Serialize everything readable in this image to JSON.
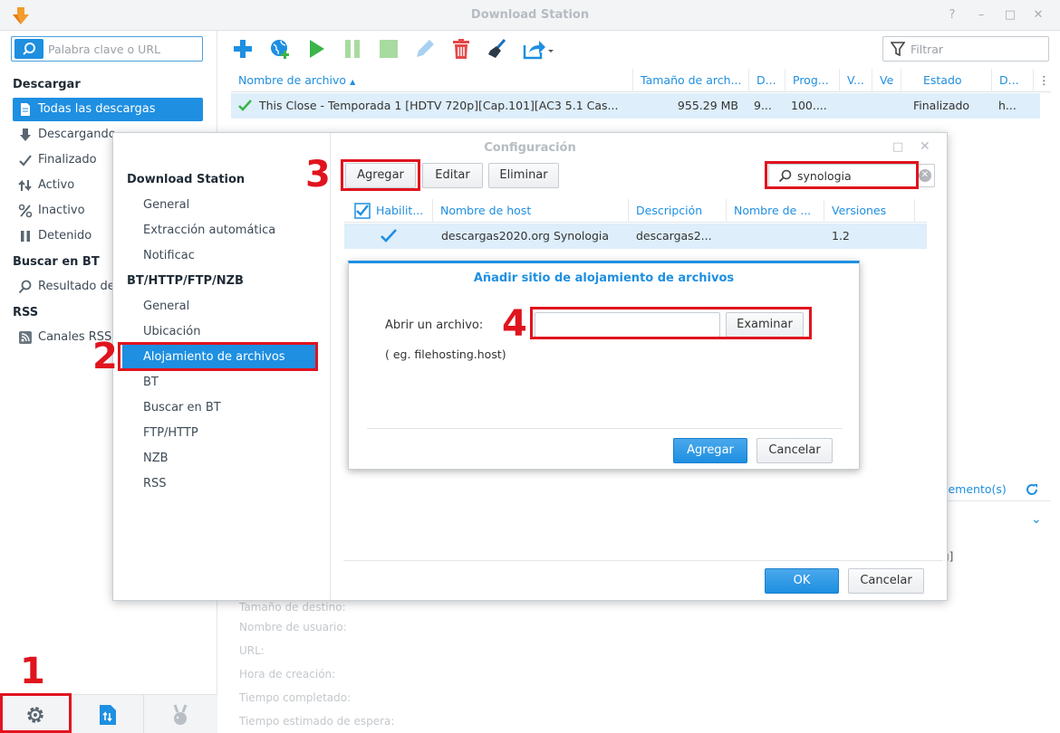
{
  "window": {
    "title": "Download Station"
  },
  "sidebar": {
    "search_placeholder": "Palabra clave o URL",
    "sections": {
      "descargar": "Descargar",
      "buscar_bt": "Buscar en BT",
      "rss": "RSS"
    },
    "items": [
      {
        "label": "Todas las descargas",
        "icon": "document-icon"
      },
      {
        "label": "Descargando",
        "icon": "arrow-down-icon"
      },
      {
        "label": "Finalizado",
        "icon": "checkmark-icon"
      },
      {
        "label": "Activo",
        "icon": "up-down-arrows-icon"
      },
      {
        "label": "Inactivo",
        "icon": "percent-icon"
      },
      {
        "label": "Detenido",
        "icon": "pause-icon"
      },
      {
        "label": "Resultado de",
        "icon": "search-icon"
      },
      {
        "label": "Canales RSS",
        "icon": "rss-icon"
      }
    ]
  },
  "toolbar": {
    "filter_placeholder": "Filtrar"
  },
  "grid": {
    "columns": [
      "Nombre de archivo",
      "Tamaño de arch...",
      "D...",
      "Prog...",
      "V...",
      "Ve",
      "Estado",
      "D..."
    ],
    "rows": [
      {
        "name": "This Close - Temporada 1 [HDTV 720p][Cap.101][AC3 5.1 Cas...",
        "size": "955.29 MB",
        "d": "9...",
        "progress": "100....",
        "status": "Finalizado",
        "d2": "h..."
      }
    ]
  },
  "background_info": {
    "elementos": "lemento(s)",
    "labels": [
      "Tamaño de destino:",
      "Nombre de usuario:",
      "URL:",
      "Hora de creación:",
      "Tiempo completado:",
      "Tiempo estimado de espera:"
    ]
  },
  "config_dialog": {
    "title": "Configuración",
    "nav": {
      "section1": "Download Station",
      "section1_items": [
        "General",
        "Extracción automática",
        "Notificac"
      ],
      "section2": "BT/HTTP/FTP/NZB",
      "section2_items": [
        "General",
        "Ubicación",
        "Alojamiento de archivos",
        "BT",
        "Buscar en BT",
        "FTP/HTTP",
        "NZB",
        "RSS"
      ]
    },
    "buttons": {
      "add": "Agregar",
      "edit": "Editar",
      "delete": "Eliminar",
      "ok": "OK",
      "cancel": "Cancelar"
    },
    "search_value": "synologia",
    "table": {
      "columns": [
        "Habilit...",
        "Nombre de host",
        "Descripción",
        "Nombre de ...",
        "Versiones"
      ],
      "rows": [
        {
          "enabled": true,
          "host": "descargas2020.org Synologia",
          "description": "descargas2...",
          "name": "",
          "version": "1.2"
        }
      ]
    }
  },
  "add_host_dialog": {
    "title": "Añadir sitio de alojamiento de archivos",
    "open_file_label": "Abrir un archivo:",
    "browse_button": "Examinar",
    "hint": "( eg. filehosting.host)",
    "add_button": "Agregar",
    "cancel_button": "Cancelar"
  },
  "annotations": [
    "1",
    "2",
    "3",
    "4"
  ],
  "colors": {
    "accent": "#1e8fe1",
    "annotation": "#e0141e",
    "selected_row": "#deeefb"
  }
}
